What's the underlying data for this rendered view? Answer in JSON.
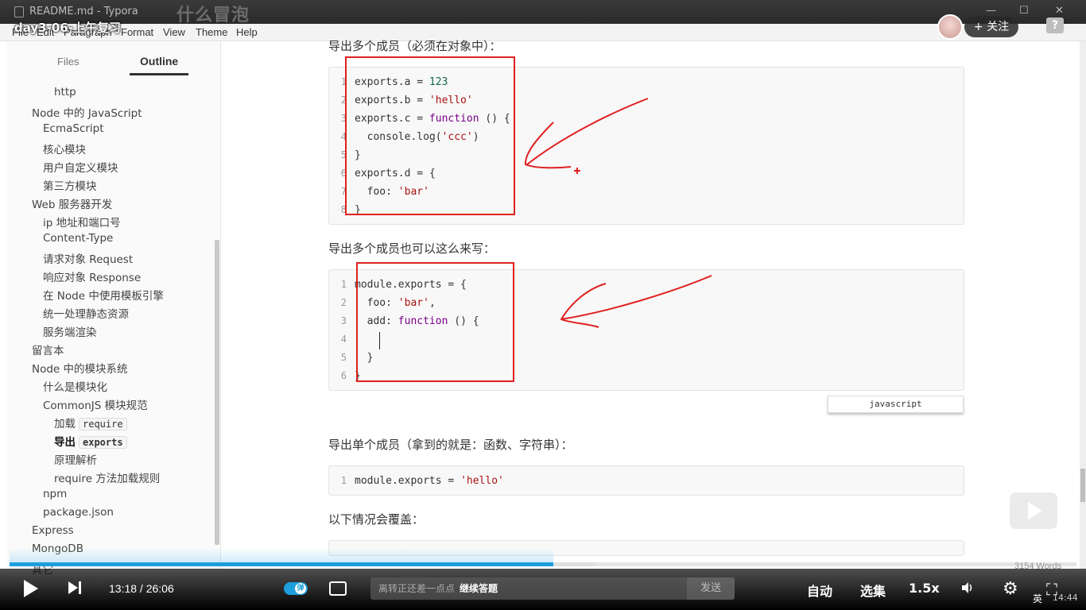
{
  "window": {
    "title": "README.md - Typora",
    "overlay_title": "什么冒泡",
    "lesson_title": "day3-06-上午复习"
  },
  "menu": [
    "File",
    "Edit",
    "Paragraph",
    "Format",
    "View",
    "Theme",
    "Help"
  ],
  "uploader": {
    "follow_label": "+ 关注",
    "help_label": "?"
  },
  "sidebar": {
    "tab_files": "Files",
    "tab_outline": "Outline",
    "outline": [
      {
        "label": "http",
        "code": "",
        "level": 3
      },
      {
        "label": "Node 中的 JavaScript",
        "code": "",
        "level": 1
      },
      {
        "label": "EcmaScript",
        "code": "",
        "level": 2
      },
      {
        "label": "核心模块",
        "code": "",
        "level": 2
      },
      {
        "label": "用户自定义模块",
        "code": "",
        "level": 2
      },
      {
        "label": "第三方模块",
        "code": "",
        "level": 2
      },
      {
        "label": "Web 服务器开发",
        "code": "",
        "level": 1
      },
      {
        "label": "ip 地址和端口号",
        "code": "",
        "level": 2
      },
      {
        "label": "Content-Type",
        "code": "",
        "level": 2
      },
      {
        "label": "请求对象 Request",
        "code": "",
        "level": 2
      },
      {
        "label": "响应对象 Response",
        "code": "",
        "level": 2
      },
      {
        "label": "在 Node 中使用模板引擎",
        "code": "",
        "level": 2
      },
      {
        "label": "统一处理静态资源",
        "code": "",
        "level": 2
      },
      {
        "label": "服务端渲染",
        "code": "",
        "level": 2
      },
      {
        "label": "留言本",
        "code": "",
        "level": 1
      },
      {
        "label": "Node 中的模块系统",
        "code": "",
        "level": 1
      },
      {
        "label": "什么是模块化",
        "code": "",
        "level": 2
      },
      {
        "label": "CommonJS 模块规范",
        "code": "",
        "level": 2
      },
      {
        "label": "加载",
        "code": "require",
        "level": 3
      },
      {
        "label": "导出",
        "code": "exports",
        "level": 3,
        "active": true
      },
      {
        "label": "原理解析",
        "code": "",
        "level": 3
      },
      {
        "label": "require 方法加载规则",
        "code": "",
        "level": 3
      },
      {
        "label": "npm",
        "code": "",
        "level": 2
      },
      {
        "label": "package.json",
        "code": "",
        "level": 2
      },
      {
        "label": "Express",
        "code": "",
        "level": 1
      },
      {
        "label": "MongoDB",
        "code": "",
        "level": 1
      },
      {
        "label": "其它",
        "code": "",
        "level": 1
      }
    ]
  },
  "editor": {
    "para1": "导出多个成员（必须在对象中）：",
    "code1": [
      "exports.a = 123",
      "exports.b = 'hello'",
      "exports.c = function () {",
      "  console.log('ccc')",
      "}",
      "exports.d = {",
      "  foo: 'bar'",
      "}"
    ],
    "para2": "导出多个成员也可以这么来写：",
    "code2": [
      "module.exports = {",
      "  foo: 'bar',",
      "  add: function () {",
      "    ",
      "  }",
      "}"
    ],
    "language": "javascript",
    "para3": "导出单个成员（拿到的就是：函数、字符串）：",
    "code3": [
      "module.exports = 'hello'"
    ],
    "para4": "以下情况会覆盖：",
    "word_count": "3154 Words",
    "annotation_color": "#e02020"
  },
  "player": {
    "current_time": "13:18",
    "duration": "26:06",
    "progress": 0.51,
    "danmaku_badge": "弹",
    "danmaku_placeholder": "离转正还差一点点",
    "danmaku_action": "继续答题",
    "send_label": "发送",
    "auto_label": "自动",
    "episodes_label": "选集",
    "speed_label": "1.5x",
    "tray_lang": "英",
    "tray_time": "14:44",
    "accent": "#1e9fdc"
  }
}
